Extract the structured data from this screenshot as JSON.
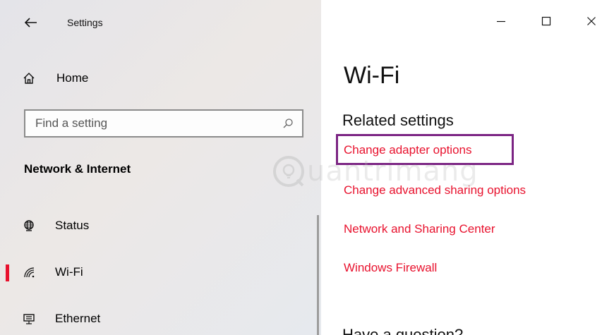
{
  "window": {
    "app_title": "Settings",
    "controls": {
      "minimize": "minimize-icon",
      "maximize": "maximize-icon",
      "close": "close-icon"
    }
  },
  "sidebar": {
    "home_label": "Home",
    "search": {
      "placeholder": "Find a setting",
      "value": ""
    },
    "section_title": "Network & Internet",
    "items": [
      {
        "label": "Status",
        "icon": "globe-icon",
        "selected": false
      },
      {
        "label": "Wi-Fi",
        "icon": "wifi-icon",
        "selected": true
      },
      {
        "label": "Ethernet",
        "icon": "ethernet-icon",
        "selected": false
      }
    ]
  },
  "main": {
    "page_title": "Wi-Fi",
    "related_title": "Related settings",
    "links": [
      "Change adapter options",
      "Change advanced sharing options",
      "Network and Sharing Center",
      "Windows Firewall"
    ],
    "cutoff_heading": "Have a question?"
  },
  "watermark": {
    "text": "uantrimang"
  },
  "colors": {
    "accent": "#e8112d",
    "highlight": "#7b2483",
    "sidebar_bg": "#e8e8ec"
  }
}
